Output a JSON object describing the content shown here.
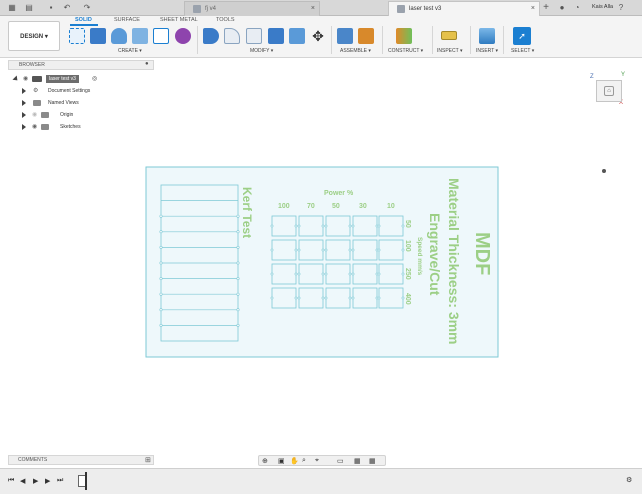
{
  "titlebar": {
    "inactive_tab": "fj v4",
    "active_tab": "laser test v3",
    "user": "Kais Alla"
  },
  "ribbon": {
    "workspace": "DESIGN",
    "tabs": [
      "SOLID",
      "SURFACE",
      "SHEET METAL",
      "TOOLS"
    ],
    "groups": [
      "CREATE",
      "MODIFY",
      "ASSEMBLE",
      "CONSTRUCT",
      "INSPECT",
      "INSERT",
      "SELECT"
    ]
  },
  "browser": {
    "title": "BROWSER",
    "root": "laser test v3",
    "items": [
      "Document Settings",
      "Named Views",
      "Origin",
      "Sketches"
    ]
  },
  "comments": {
    "title": "COMMENTS"
  },
  "sketch": {
    "kerf_title": "Kerf Test",
    "power_title": "Power %",
    "power_values": [
      "100",
      "70",
      "50",
      "30",
      "10"
    ],
    "speed_title": "Speed mm/s",
    "speed_values": [
      "50",
      "100",
      "250",
      "400"
    ],
    "material_title": "MDF",
    "material_line2": "Material Thickness: 3mm",
    "material_line3": "Engrave/Cut"
  },
  "viewcube": {
    "axis_z": "Z",
    "axis_x": "X",
    "axis_y": "Y"
  },
  "colors": {
    "sketch_line": "#7ec9d6",
    "sketch_text": "#9ccf86",
    "sketch_fill": "#eef8fb",
    "accent": "#1b7fd1"
  }
}
